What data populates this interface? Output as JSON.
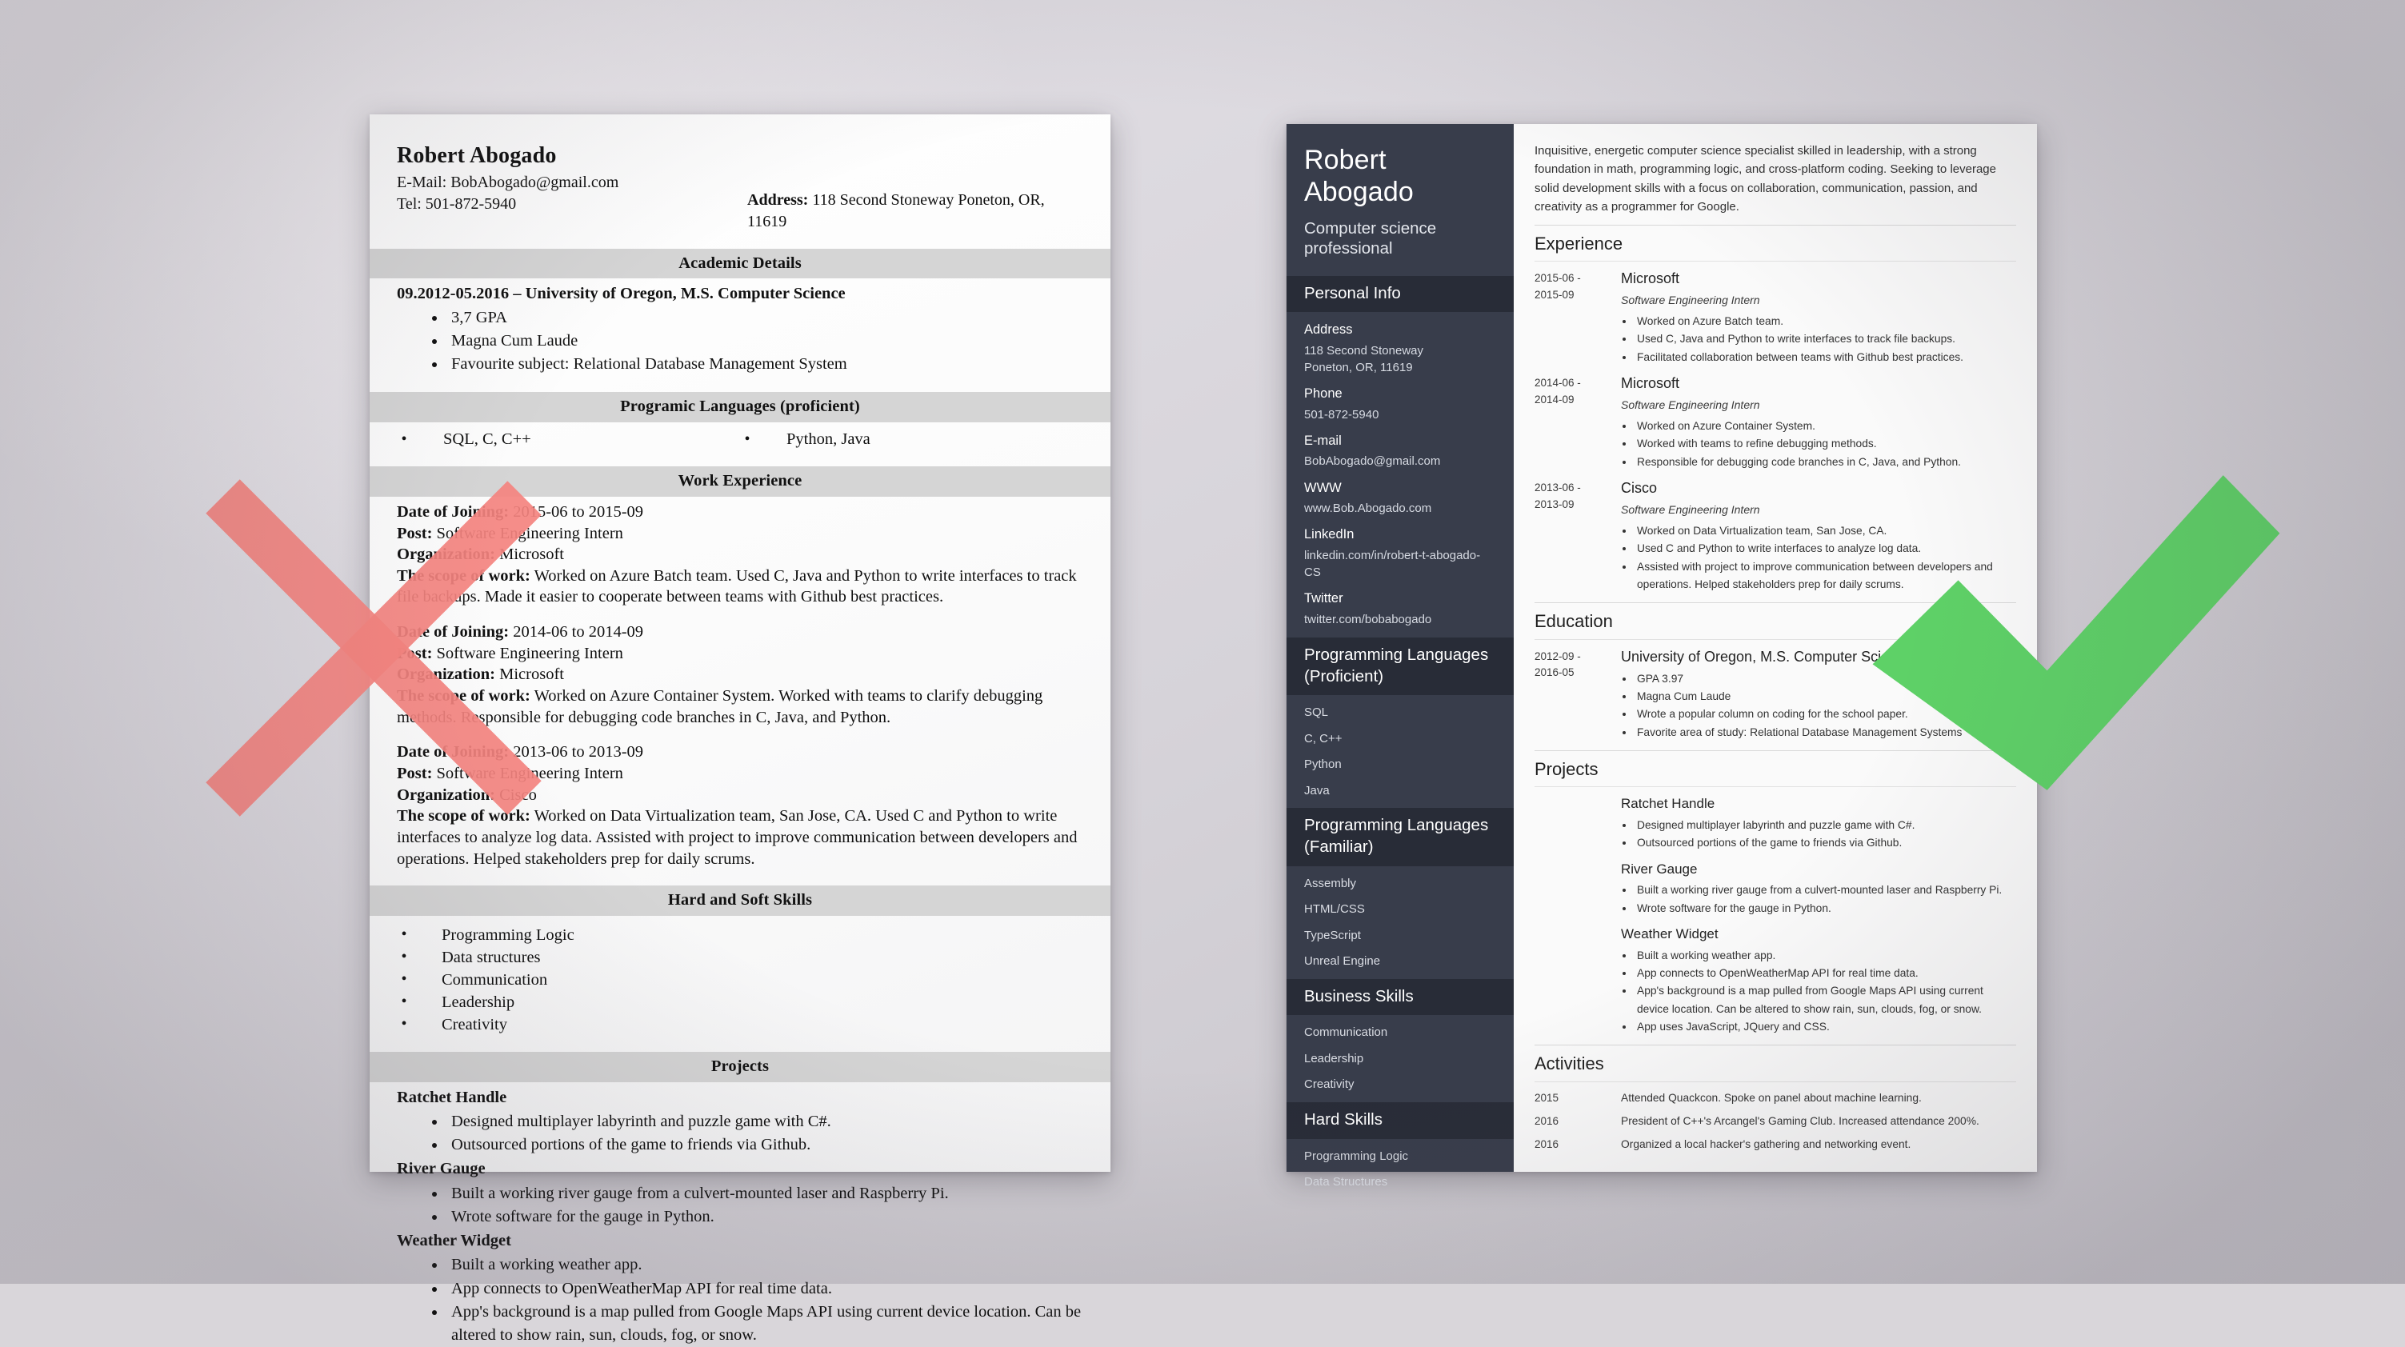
{
  "colors": {
    "reject_mark": "#f4837f",
    "approve_mark": "#5ed167",
    "sidebar_bg": "#383d4b",
    "sidebar_head_bg": "#282c37",
    "band_bg": "#d5d5d5"
  },
  "marks": {
    "reject": {
      "icon": "x-mark-icon",
      "meaning": "bad-resume-example"
    },
    "approve": {
      "icon": "check-mark-icon",
      "meaning": "good-resume-example"
    }
  },
  "bad_resume": {
    "name": "Robert Abogado",
    "email_line": "E-Mail: BobAbogado@gmail.com",
    "tel_line": "Tel: 501-872-5940",
    "address_label": "Address:",
    "address_value": "118 Second Stoneway Poneton, OR, 11619",
    "academic_heading": "Academic Details",
    "academic_line": "09.2012-05.2016 – University of Oregon, M.S. Computer Science",
    "academic_bullets": [
      "3,7 GPA",
      "Magna Cum Laude",
      "Favourite subject: Relational Database Management System"
    ],
    "languages_heading": "Programic Languages (proficient)",
    "languages_left": "SQL, C, C++",
    "languages_right": "Python, Java",
    "work_heading": "Work Experience",
    "work_labels": {
      "date": "Date of Joining:",
      "post": "Post:",
      "org": "Organization:",
      "scope": "The scope of work:"
    },
    "work_entries": [
      {
        "date": "2015-06 to 2015-09",
        "post": "Software Engineering Intern",
        "org": "Microsoft",
        "scope": "Worked on Azure Batch team. Used C, Java and Python to write interfaces to track file backups. Made it easier to cooperate between teams with Github best practices."
      },
      {
        "date": "2014-06 to 2014-09",
        "post": "Software Engineering Intern",
        "org": "Microsoft",
        "scope": "Worked on Azure Container System. Worked with teams to clarify debugging methods. Responsible for debugging code branches in C, Java, and Python."
      },
      {
        "date": "2013-06 to 2013-09",
        "post": "Software Engineering Intern",
        "org": "Cisco",
        "scope": "Worked on Data Virtualization team, San Jose, CA. Used C and Python to write interfaces to analyze log data. Assisted with project to improve communication between developers and operations. Helped stakeholders prep for daily scrums."
      }
    ],
    "skills_heading": "Hard and Soft Skills",
    "skills": [
      "Programming Logic",
      "Data structures",
      "Communication",
      "Leadership",
      "Creativity"
    ],
    "projects_heading": "Projects",
    "projects": [
      {
        "title": "Ratchet Handle",
        "bullets": [
          "Designed multiplayer labyrinth and puzzle game with C#.",
          "Outsourced portions of the game to friends via Github."
        ]
      },
      {
        "title": "River Gauge",
        "bullets": [
          "Built a working river gauge from a culvert-mounted laser and Raspberry Pi.",
          "Wrote software for the gauge in Python."
        ]
      },
      {
        "title": "Weather Widget",
        "bullets": [
          "Built a working weather app.",
          "App connects to OpenWeatherMap API for real time data.",
          "App's background is a map pulled from Google Maps API using current device location. Can be altered to show rain, sun, clouds, fog, or snow."
        ]
      }
    ]
  },
  "good_resume": {
    "sidebar": {
      "name": "Robert Abogado",
      "role": "Computer science professional",
      "personal_info_heading": "Personal Info",
      "personal_info": [
        {
          "label": "Address",
          "value": "118 Second Stoneway\nPoneton, OR, 11619"
        },
        {
          "label": "Phone",
          "value": "501-872-5940"
        },
        {
          "label": "E-mail",
          "value": "BobAbogado@gmail.com"
        },
        {
          "label": "WWW",
          "value": "www.Bob.Abogado.com"
        },
        {
          "label": "LinkedIn",
          "value": "linkedin.com/in/robert-t-abogado-CS"
        },
        {
          "label": "Twitter",
          "value": "twitter.com/bobabogado"
        }
      ],
      "proficient_heading": "Programming Languages (Proficient)",
      "proficient": [
        "SQL",
        "C, C++",
        "Python",
        "Java"
      ],
      "familiar_heading": "Programming Languages (Familiar)",
      "familiar": [
        "Assembly",
        "HTML/CSS",
        "TypeScript",
        "Unreal Engine"
      ],
      "business_heading": "Business Skills",
      "business": [
        "Communication",
        "Leadership",
        "Creativity"
      ],
      "hard_heading": "Hard Skills",
      "hard": [
        "Programming Logic",
        "Data Structures"
      ]
    },
    "summary": "Inquisitive, energetic computer science specialist skilled in leadership, with a strong foundation in math, programming logic, and cross-platform coding. Seeking to leverage solid development skills with a focus on collaboration, communication, passion, and creativity as a programmer for Google.",
    "experience_heading": "Experience",
    "experience": [
      {
        "date": "2015-06 -\n2015-09",
        "org": "Microsoft",
        "position": "Software Engineering Intern",
        "bullets": [
          "Worked on Azure Batch team.",
          "Used C, Java and Python to write interfaces to track file backups.",
          "Facilitated collaboration between teams with Github best practices."
        ]
      },
      {
        "date": "2014-06 -\n2014-09",
        "org": "Microsoft",
        "position": "Software Engineering Intern",
        "bullets": [
          "Worked on Azure Container System.",
          "Worked with teams to refine debugging methods.",
          "Responsible for debugging code branches in C, Java, and Python."
        ]
      },
      {
        "date": "2013-06 -\n2013-09",
        "org": "Cisco",
        "position": "Software Engineering Intern",
        "bullets": [
          "Worked on Data Virtualization team, San Jose, CA.",
          "Used C and Python to write interfaces to analyze log data.",
          "Assisted with project to improve communication between developers and operations. Helped stakeholders prep for daily scrums."
        ]
      }
    ],
    "education_heading": "Education",
    "education": [
      {
        "date": "2012-09 -\n2016-05",
        "org": "University of Oregon, M.S. Computer Science",
        "bullets": [
          "GPA 3.97",
          "Magna Cum Laude",
          "Wrote a popular column on coding for the school paper.",
          "Favorite area of study: Relational Database Management Systems"
        ]
      }
    ],
    "projects_heading": "Projects",
    "projects": [
      {
        "title": "Ratchet Handle",
        "bullets": [
          "Designed multiplayer labyrinth and puzzle game with C#.",
          "Outsourced portions of the game to friends via Github."
        ]
      },
      {
        "title": "River Gauge",
        "bullets": [
          "Built a working river gauge from a culvert-mounted laser and Raspberry Pi.",
          "Wrote software for the gauge in Python."
        ]
      },
      {
        "title": "Weather Widget",
        "bullets": [
          "Built a working weather app.",
          "App connects to OpenWeatherMap API for real time data.",
          "App's background is a map pulled from Google Maps API using current device location. Can be altered to show rain, sun, clouds, fog, or snow.",
          "App uses JavaScript, JQuery and CSS."
        ]
      }
    ],
    "activities_heading": "Activities",
    "activities": [
      {
        "year": "2015",
        "text": "Attended Quackcon. Spoke on panel about machine learning."
      },
      {
        "year": "2016",
        "text": "President of C++'s Arcangel's Gaming Club. Increased attendance 200%."
      },
      {
        "year": "2016",
        "text": "Organized a local hacker's gathering and networking event."
      }
    ]
  }
}
